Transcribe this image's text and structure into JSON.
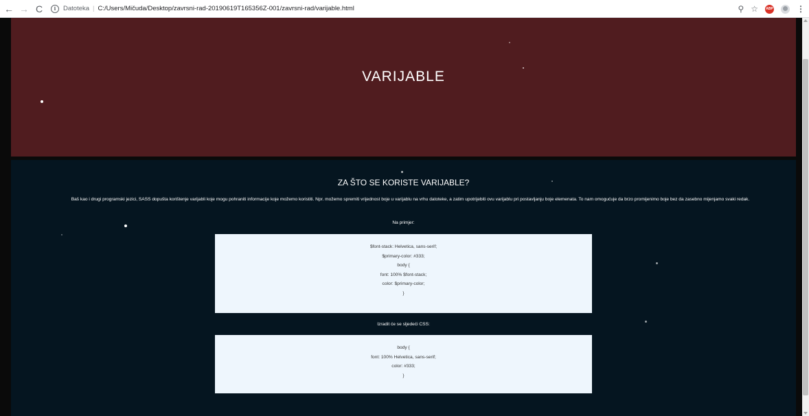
{
  "browser": {
    "security_label": "Datoteka",
    "separator": "|",
    "url": "C:/Users/Mičuda/Desktop/zavrsni-rad-20190619T165356Z-001/zavrsni-rad/varijable.html",
    "extension_label": "ABP"
  },
  "hero": {
    "title": "VARIJABLE"
  },
  "content": {
    "heading": "ZA ŠTO SE KORISTE VARIJABLE?",
    "intro": "Baš kao i drugi programski jezici, SASS dopušta korištenje varijabli koje mogu pohraniti informacije koje možemo koristiti. Npr. možemo spremiti vrijednost boje u varijablu na vrhu datoteke, a zatim upotrijebiti ovu varijablu pri postavljanju boje elemenata. To nam omogućuje da brzo promijenimo boje bez da zasebno mijenjamo svaki redak.",
    "example_label": "Na primjer:",
    "example_code": [
      "$font-stack: Helvetica, sans-serif;",
      "$primary-color: #333;",
      "body {",
      "font: 100% $font-stack;",
      "color: $primary-color;",
      "}"
    ],
    "output_label": "Izradit će se sljedeći CSS:",
    "output_code": [
      "body {",
      "font: 100% Helvetica, sans-serif;",
      "color: #333;",
      "}"
    ]
  },
  "colors": {
    "hero_bg": "#501c1f",
    "content_bg": "#051520",
    "code_bg": "#eef6fd",
    "page_bg": "#0a0a0a"
  }
}
